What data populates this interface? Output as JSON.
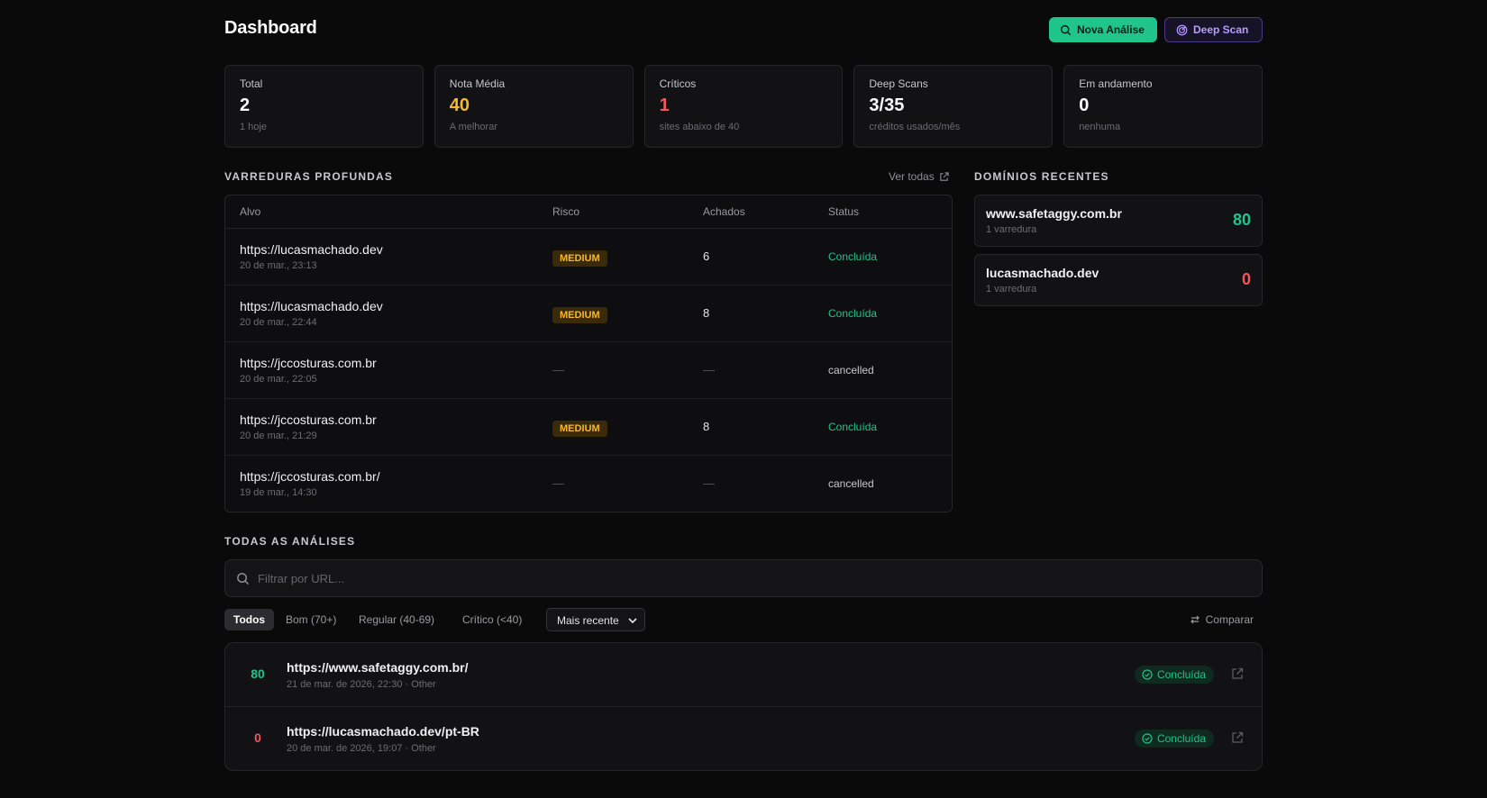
{
  "header": {
    "title": "Dashboard",
    "new_analysis_label": "Nova Análise",
    "deep_scan_label": "Deep Scan"
  },
  "stats": [
    {
      "label": "Total",
      "value": "2",
      "sub": "1 hoje",
      "color": "#ffffff"
    },
    {
      "label": "Nota Média",
      "value": "40",
      "sub": "A melhorar",
      "color": "#f5b82e"
    },
    {
      "label": "Críticos",
      "value": "1",
      "sub": "sites abaixo de 40",
      "color": "#f2555a"
    },
    {
      "label": "Deep Scans",
      "value": "3/35",
      "sub": "créditos usados/mês",
      "color": "#ffffff"
    },
    {
      "label": "Em andamento",
      "value": "0",
      "sub": "nenhuma",
      "color": "#ffffff"
    }
  ],
  "deep_scans": {
    "title": "VARREDURAS PROFUNDAS",
    "see_all": "Ver todas",
    "columns": [
      "Alvo",
      "Risco",
      "Achados",
      "Status"
    ],
    "rows": [
      {
        "url": "https://lucasmachado.dev",
        "date": "20 de mar., 23:13",
        "risk": "MEDIUM",
        "findings": "6",
        "status": "Concluída"
      },
      {
        "url": "https://lucasmachado.dev",
        "date": "20 de mar., 22:44",
        "risk": "MEDIUM",
        "findings": "8",
        "status": "Concluída"
      },
      {
        "url": "https://jccosturas.com.br",
        "date": "20 de mar., 22:05",
        "risk": "—",
        "findings": "—",
        "status": "cancelled"
      },
      {
        "url": "https://jccosturas.com.br",
        "date": "20 de mar., 21:29",
        "risk": "MEDIUM",
        "findings": "8",
        "status": "Concluída"
      },
      {
        "url": "https://jccosturas.com.br/",
        "date": "19 de mar., 14:30",
        "risk": "—",
        "findings": "—",
        "status": "cancelled"
      }
    ]
  },
  "recent_domains": {
    "title": "DOMÍNIOS RECENTES",
    "items": [
      {
        "name": "www.safetaggy.com.br",
        "sub": "1 varredura",
        "score": "80",
        "color": "#1fc58a"
      },
      {
        "name": "lucasmachado.dev",
        "sub": "1 varredura",
        "score": "0",
        "color": "#f2555a"
      }
    ]
  },
  "all_analyses": {
    "title": "TODAS AS ANÁLISES",
    "search_placeholder": "Filtrar por URL...",
    "filters": [
      "Todos",
      "Bom (70+)",
      "Regular (40-69)",
      "Crítico (<40)"
    ],
    "active_filter": "Todos",
    "sort_selected": "Mais recente",
    "compare_label": "Comparar",
    "items": [
      {
        "score": "80",
        "url": "https://www.safetaggy.com.br/",
        "meta": "21 de mar. de 2026, 22:30 · Other",
        "status": "Concluída",
        "color": "#1fc58a"
      },
      {
        "score": "0",
        "url": "https://lucasmachado.dev/pt-BR",
        "meta": "20 de mar. de 2026, 19:07 · Other",
        "status": "Concluída",
        "color": "#f2555a"
      }
    ]
  }
}
